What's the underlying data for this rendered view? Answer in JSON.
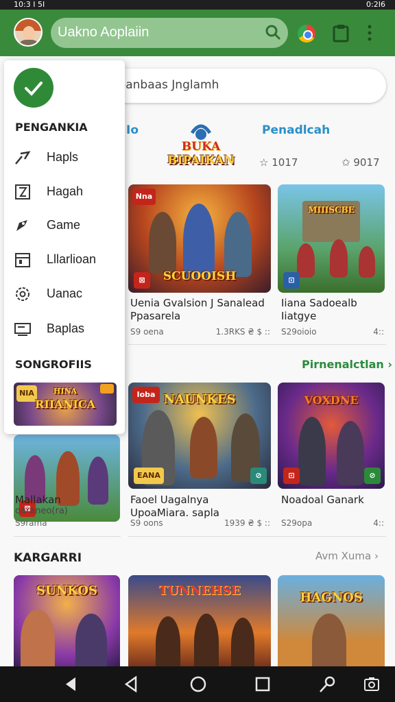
{
  "status_bar": {
    "time_left": "10:3 I 5I",
    "time_right": "0:2I6"
  },
  "appbar": {
    "search_text": "Uakno Aoplaiin"
  },
  "search": {
    "placeholder": "Iopanbaas Jnglamh"
  },
  "tabs": {
    "left": "Io",
    "right": "Penadlcah"
  },
  "logo_art": {
    "line1": "BUKA",
    "line2": "BIPAIKAN"
  },
  "ratings": {
    "r1": "1017",
    "r2": "9017"
  },
  "drawer": {
    "section1": "PENGANKIA",
    "items": [
      {
        "label": "Hapls",
        "icon": "tool-icon"
      },
      {
        "label": "Hagah",
        "icon": "hourglass-icon"
      },
      {
        "label": "Game",
        "icon": "gamepad-icon"
      },
      {
        "label": "Lllarlioan",
        "icon": "calendar-icon"
      },
      {
        "label": "Uanac",
        "icon": "settings-icon"
      },
      {
        "label": "Baplas",
        "icon": "monitor-icon"
      }
    ],
    "section2": "SONGROFIIS",
    "thumb_badge": "NIA",
    "thumb_title1": "HINA",
    "thumb_title2": "RIIANICA"
  },
  "row1": [
    {
      "badge": "Nna",
      "art": "SCUOOISH",
      "title": "Uenia Gvalsion J Sanalead Ppasarela",
      "meta_left": "S9 oena",
      "meta_right": "1.3RKS   ₴ $ ::"
    },
    {
      "art": "MIIISCBE",
      "title": "Iiana Sadoealb Iiatgye",
      "meta_left": "S29oioio",
      "meta_right": "4::"
    }
  ],
  "section_a": {
    "see_all": "Pirnenalctlan"
  },
  "row2": [
    {
      "title": "Mallakan",
      "subtitle": "oaraneo(ra)",
      "meta_left": "S9rama"
    },
    {
      "badge": "Ioba",
      "art": "NAUNKES",
      "small": "EANA",
      "title": "Faoel Uagalnya UpoaMiara. sapla",
      "meta_left": "S9 oons",
      "meta_right": "1939   ₴ $ ::"
    },
    {
      "art": "VOXDNE",
      "title": "Noadoal Ganark",
      "meta_left": "S29opa",
      "meta_right": "4::"
    }
  ],
  "section_b": {
    "title": "KARGARRI",
    "see_all": "Avm  Xuma"
  },
  "row3": [
    {
      "art": "SUNKOS"
    },
    {
      "art": "TUNNEHSE"
    },
    {
      "art": "HAGNOS"
    }
  ],
  "colors": {
    "appbar": "#3a8a3c",
    "accent_blue": "#2a8fc9",
    "accent_green": "#2b8a3e"
  }
}
